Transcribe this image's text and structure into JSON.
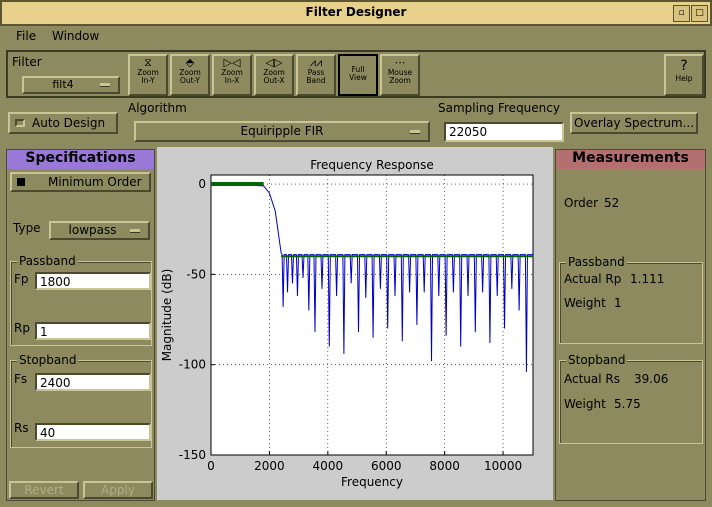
{
  "window": {
    "title": "Filter Designer"
  },
  "menu": [
    "File",
    "Window"
  ],
  "toolbar": {
    "filter_label": "Filter",
    "filter_value": "filt4",
    "tools": [
      {
        "l1": "Zoom",
        "l2": "In-Y",
        "icon": "⧖",
        "name": "zoom-in-y-button"
      },
      {
        "l1": "Zoom",
        "l2": "Out-Y",
        "icon": "⬘",
        "name": "zoom-out-y-button"
      },
      {
        "l1": "Zoom",
        "l2": "In-X",
        "icon": "▷◁",
        "name": "zoom-in-x-button"
      },
      {
        "l1": "Zoom",
        "l2": "Out-X",
        "icon": "◁▷",
        "name": "zoom-out-x-button"
      },
      {
        "l1": "Pass",
        "l2": "Band",
        "icon": "⩘⩘",
        "name": "pass-band-button"
      },
      {
        "l1": "Full",
        "l2": "View",
        "icon": "",
        "name": "full-view-button"
      },
      {
        "l1": "Mouse",
        "l2": "Zoom",
        "icon": "⋯",
        "name": "mouse-zoom-button"
      }
    ],
    "help_label": "Help",
    "help_icon": "?"
  },
  "controls": {
    "auto_design": "Auto Design",
    "algorithm_label": "Algorithm",
    "algorithm_value": "Equiripple FIR",
    "sampling_label": "Sampling Frequency",
    "sampling_value": "22050",
    "overlay_button": "Overlay Spectrum..."
  },
  "specs": {
    "header": "Specifications",
    "minimum_order": "Minimum Order",
    "type_label": "Type",
    "type_value": "lowpass",
    "passband_title": "Passband",
    "fp_label": "Fp",
    "fp_value": "1800",
    "rp_label": "Rp",
    "rp_value": "1",
    "stopband_title": "Stopband",
    "fs_label": "Fs",
    "fs_value": "2400",
    "rs_label": "Rs",
    "rs_value": "40",
    "revert": "Revert",
    "apply": "Apply"
  },
  "measurements": {
    "header": "Measurements",
    "order_label": "Order",
    "order_value": "52",
    "passband_title": "Passband",
    "actual_rp_label": "Actual Rp",
    "actual_rp_value": "1.111",
    "weight_p_label": "Weight",
    "weight_p_value": "1",
    "stopband_title": "Stopband",
    "actual_rs_label": "Actual Rs",
    "actual_rs_value": "39.06",
    "weight_s_label": "Weight",
    "weight_s_value": "5.75"
  },
  "colors": {
    "spec_header": "#9a78d8",
    "meas_header": "#b47070",
    "response_line": "#0000cc",
    "spec_line": "#006400"
  },
  "chart_data": {
    "type": "line",
    "title": "Frequency Response",
    "xlabel": "Frequency",
    "ylabel": "Magnitude (dB)",
    "xlim": [
      0,
      11025
    ],
    "ylim": [
      -150,
      5
    ],
    "xticks": [
      0,
      2000,
      4000,
      6000,
      8000,
      10000
    ],
    "yticks": [
      0,
      -50,
      -100,
      -150
    ],
    "grid": true,
    "spec_lines": {
      "passband": {
        "x": [
          0,
          1800
        ],
        "y": 0
      },
      "stopband": {
        "x": [
          2400,
          11025
        ],
        "y": -40
      }
    },
    "response": {
      "transition": [
        [
          0,
          0
        ],
        [
          1800,
          -1
        ],
        [
          2000,
          -5
        ],
        [
          2200,
          -15
        ],
        [
          2400,
          -38
        ]
      ],
      "stopband_level": -39.06,
      "nulls": [
        [
          2470,
          -68
        ],
        [
          2620,
          -60
        ],
        [
          2790,
          -55
        ],
        [
          2960,
          -62
        ],
        [
          3150,
          -52
        ],
        [
          3350,
          -70
        ],
        [
          3560,
          -82
        ],
        [
          3800,
          -58
        ],
        [
          4050,
          -90
        ],
        [
          4300,
          -62
        ],
        [
          4550,
          -94
        ],
        [
          4800,
          -55
        ],
        [
          5050,
          -82
        ],
        [
          5300,
          -63
        ],
        [
          5550,
          -85
        ],
        [
          5800,
          -58
        ],
        [
          6050,
          -80
        ],
        [
          6300,
          -62
        ],
        [
          6550,
          -87
        ],
        [
          6800,
          -60
        ],
        [
          7050,
          -78
        ],
        [
          7300,
          -60
        ],
        [
          7550,
          -98
        ],
        [
          7800,
          -62
        ],
        [
          8050,
          -84
        ],
        [
          8300,
          -60
        ],
        [
          8550,
          -90
        ],
        [
          8800,
          -62
        ],
        [
          9050,
          -82
        ],
        [
          9300,
          -60
        ],
        [
          9550,
          -88
        ],
        [
          9800,
          -62
        ],
        [
          10050,
          -80
        ],
        [
          10300,
          -58
        ],
        [
          10550,
          -70
        ],
        [
          10800,
          -104
        ]
      ]
    }
  }
}
